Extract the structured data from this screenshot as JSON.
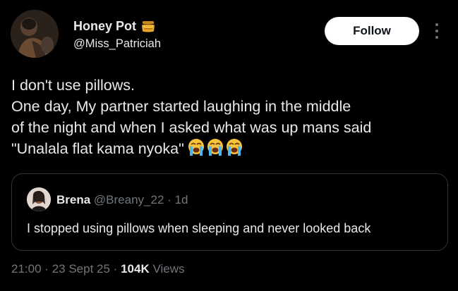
{
  "author": {
    "display_name": "Honey Pot",
    "name_badge_icon": "honey-pot-emoji",
    "handle": "@Miss_Patriciah"
  },
  "actions": {
    "follow_label": "Follow",
    "more_icon": "more-vertical-icon"
  },
  "post": {
    "lines": [
      "I don't use pillows.",
      "One day, My partner started laughing  in the middle",
      "of the night and when I asked what was up mans said",
      "\"Unalala  flat kama nyoka\""
    ],
    "emoji": [
      "loudly-crying-face",
      "loudly-crying-face",
      "loudly-crying-face"
    ]
  },
  "quote": {
    "name": "Brena",
    "handle": "@Breany_22",
    "separator": "·",
    "time": "1d",
    "text": "I stopped using pillows when sleeping and never looked back"
  },
  "footer": {
    "time": "21:00",
    "separator": "·",
    "date": "23 Sept 25",
    "views_count": "104K",
    "views_label": "Views"
  },
  "colors": {
    "background": "#000000",
    "text_primary": "#e7e9ea",
    "text_secondary": "#71767b",
    "border": "#2f3336",
    "follow_bg": "#ffffff"
  }
}
